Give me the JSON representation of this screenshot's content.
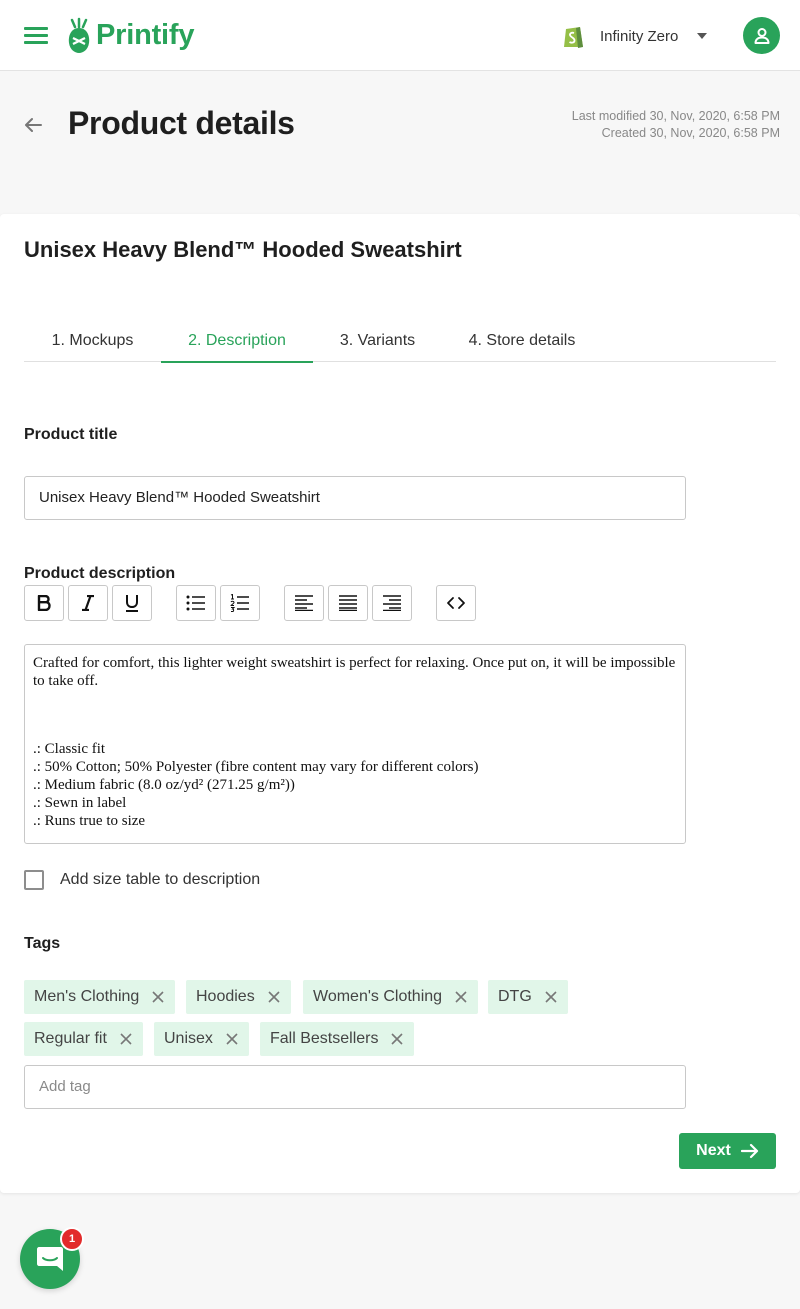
{
  "header": {
    "brand": "Printify",
    "store_name": "Infinity Zero"
  },
  "page": {
    "title": "Product details",
    "last_modified": "Last modified 30, Nov, 2020, 6:58 PM",
    "created": "Created 30, Nov, 2020, 6:58 PM"
  },
  "product": {
    "name": "Unisex Heavy Blend™ Hooded Sweatshirt"
  },
  "tabs": [
    {
      "label": "1. Mockups"
    },
    {
      "label": "2. Description",
      "active": true
    },
    {
      "label": "3. Variants"
    },
    {
      "label": "4. Store details"
    }
  ],
  "form": {
    "title_label": "Product title",
    "title_value": "Unisex Heavy Blend™ Hooded Sweatshirt",
    "description_label": "Product description",
    "description_intro": "Crafted for comfort, this lighter weight sweatshirt is perfect for relaxing. Once put on, it will be impossible to take off.",
    "description_bullets": [
      ".: Classic fit",
      ".: 50% Cotton; 50% Polyester (fibre content may vary for different colors)",
      ".: Medium fabric (8.0 oz/yd² (271.25 g/m²))",
      ".: Sewn in label",
      ".: Runs true to size"
    ],
    "size_table_label": "Add size table to description",
    "size_table_checked": false,
    "tags_label": "Tags",
    "tags": [
      "Men's Clothing",
      "Hoodies",
      "Women's Clothing",
      "DTG",
      "Regular fit",
      "Unisex",
      "Fall Bestsellers"
    ],
    "add_tag_placeholder": "Add tag"
  },
  "toolbar": [
    "bold-icon",
    "italic-icon",
    "underline-icon",
    "bullet-list-icon",
    "numbered-list-icon",
    "align-left-icon",
    "align-justify-icon",
    "align-right-icon",
    "code-icon"
  ],
  "actions": {
    "next_label": "Next"
  },
  "chat": {
    "unread": "1"
  },
  "colors": {
    "brand_green": "#29a35a",
    "tag_bg": "#e1f6e9",
    "badge_red": "#e22b2b"
  }
}
